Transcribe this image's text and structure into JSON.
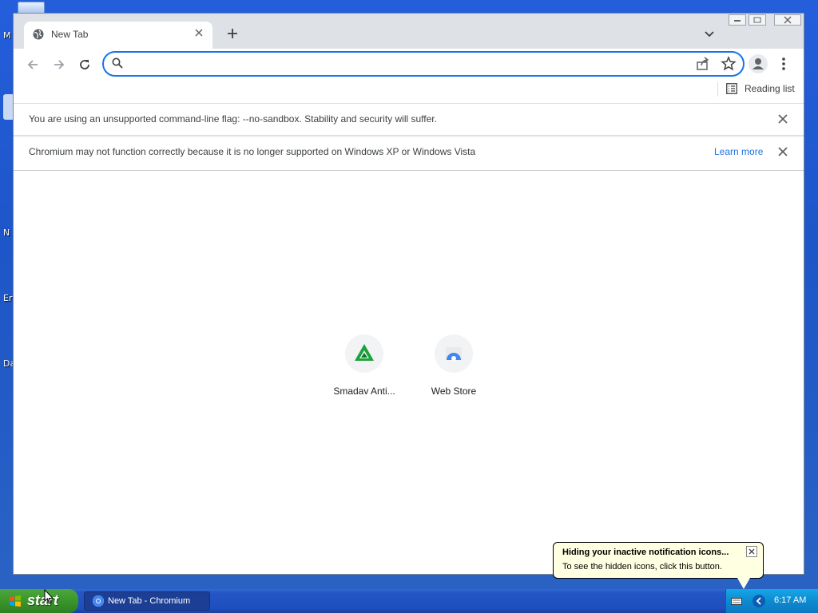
{
  "desktop": {
    "icon_labels": [
      "M",
      "N",
      "Er",
      "Da"
    ]
  },
  "window": {
    "tab": {
      "title": "New Tab",
      "icon": "globe-icon"
    },
    "toolbar": {
      "omnibox_value": "",
      "reading_list_label": "Reading list"
    },
    "infobars": [
      {
        "text": "You are using an unsupported command-line flag: --no-sandbox. Stability and security will suffer."
      },
      {
        "text": "Chromium may not function correctly because it is no longer supported on Windows XP or Windows Vista",
        "link": "Learn more"
      }
    ],
    "shortcuts": [
      {
        "label": "Smadav Anti...",
        "icon": "smadav-logo-icon",
        "color": "#1aa33a"
      },
      {
        "label": "Web Store",
        "icon": "webstore-icon",
        "color": "#4285f4"
      }
    ],
    "accent_color": "#1a73e8"
  },
  "balloon": {
    "title": "Hiding your inactive notification icons...",
    "text": "To see the hidden icons, click this button."
  },
  "taskbar": {
    "start_label": "start",
    "task_label": "New Tab - Chromium",
    "clock": "6:17 AM"
  }
}
